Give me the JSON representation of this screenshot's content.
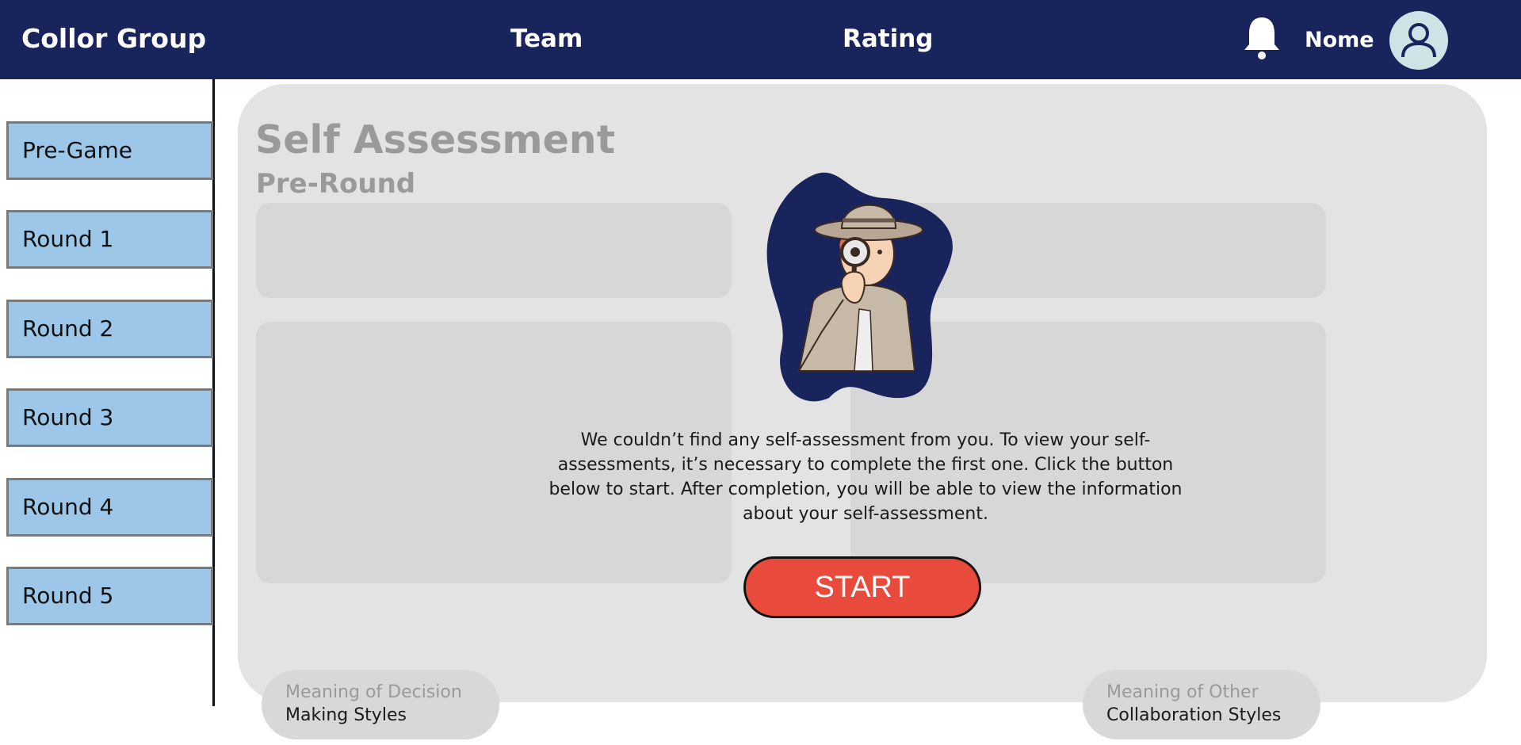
{
  "header": {
    "brand": "Collor Group",
    "nav": [
      {
        "label": "Team"
      },
      {
        "label": "Rating"
      }
    ],
    "user_name": "Nome",
    "notification_icon": "bell-icon",
    "avatar_icon": "user-icon"
  },
  "sidebar": {
    "items": [
      {
        "label": "Pre-Game"
      },
      {
        "label": "Round 1"
      },
      {
        "label": "Round 2"
      },
      {
        "label": "Round 3"
      },
      {
        "label": "Round 4"
      },
      {
        "label": "Round 5"
      }
    ]
  },
  "main": {
    "title": "Self Assessment",
    "subtitle": "Pre-Round",
    "empty_state": {
      "illustration": "detective-with-magnifier",
      "message": "We couldn’t find any self-assessment from you. To view your self-assessments, it’s necessary to complete the first one. Click the button below to start. After completion, you will be able to view the information about your self-assessment.",
      "button_label": "START"
    },
    "info_links": [
      {
        "line1": "Meaning of Decision",
        "line2": "Making Styles"
      },
      {
        "line1": "Meaning of Other",
        "line2": "Collaboration Styles"
      }
    ]
  },
  "colors": {
    "header_bg": "#19235c",
    "sidebar_item_bg": "#9dc7e8",
    "panel_bg": "#e3e3e3",
    "start_button": "#e84a3c",
    "illustration_blob": "#19235c"
  }
}
